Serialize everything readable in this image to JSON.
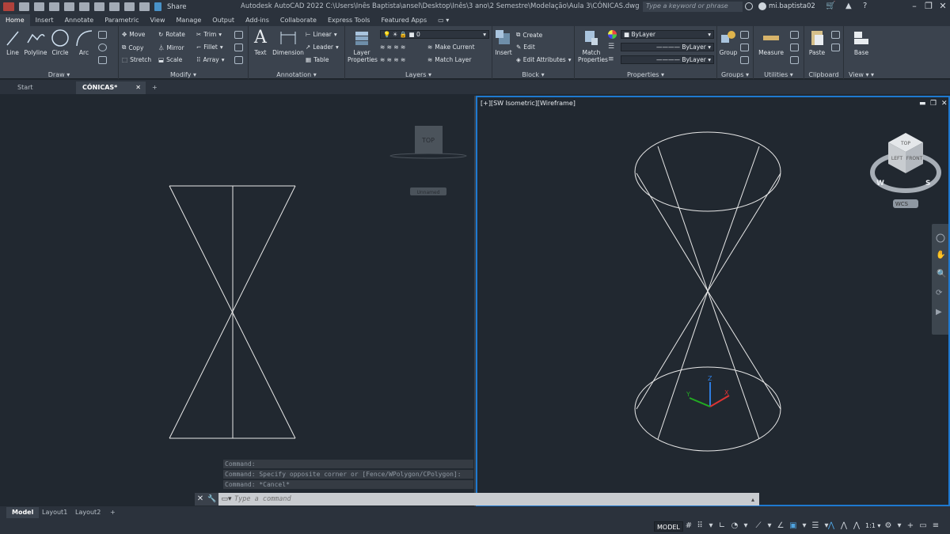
{
  "titlebar": {
    "app_title": "Autodesk AutoCAD 2022    C:\\Users\\Inês Baptista\\ansel\\Desktop\\Inês\\3 ano\\2 Semestre\\Modelação\\Aula 3\\CÓNICAS.dwg",
    "share_label": "Share",
    "search_placeholder": "Type a keyword or phrase",
    "username": "mi.baptista02"
  },
  "ribbon_tabs": [
    "Home",
    "Insert",
    "Annotate",
    "Parametric",
    "View",
    "Manage",
    "Output",
    "Add-ins",
    "Collaborate",
    "Express Tools",
    "Featured Apps"
  ],
  "ribbon": {
    "draw": {
      "title": "Draw",
      "line": "Line",
      "polyline": "Polyline",
      "circle": "Circle",
      "arc": "Arc"
    },
    "modify": {
      "title": "Modify",
      "move": "Move",
      "rotate": "Rotate",
      "trim": "Trim",
      "copy": "Copy",
      "mirror": "Mirror",
      "fillet": "Fillet",
      "stretch": "Stretch",
      "scale": "Scale",
      "array": "Array"
    },
    "annotation": {
      "title": "Annotation",
      "text": "Text",
      "dimension": "Dimension",
      "linear": "Linear",
      "leader": "Leader",
      "table": "Table"
    },
    "layers": {
      "title": "Layers",
      "layer_properties": "Layer Properties",
      "current_layer": "0",
      "make_current": "Make Current",
      "match_layer": "Match Layer"
    },
    "block": {
      "title": "Block",
      "insert": "Insert",
      "create": "Create",
      "edit": "Edit",
      "edit_attributes": "Edit Attributes"
    },
    "properties": {
      "title": "Properties",
      "match_properties": "Match Properties",
      "color": "ByLayer",
      "linetype": "ByLayer",
      "lineweight": "ByLayer"
    },
    "groups": {
      "title": "Groups",
      "group": "Group"
    },
    "utilities": {
      "title": "Utilities",
      "measure": "Measure"
    },
    "clipboard": {
      "title": "Clipboard",
      "paste": "Paste"
    },
    "view": {
      "title": "View",
      "base": "Base"
    }
  },
  "file_tabs": {
    "start": "Start",
    "active": "CÓNICAS*"
  },
  "viewport_left": {
    "viewcube_label": "TOP",
    "wcs_label": "Unnamed"
  },
  "viewport_right": {
    "label": "[+][SW Isometric][Wireframe]",
    "viewcube_top": "TOP",
    "viewcube_left": "LEFT",
    "viewcube_front": "FRONT",
    "compass_w": "W",
    "compass_s": "S",
    "wcs_label": "WCS"
  },
  "command_line": {
    "history": [
      "Command:",
      "Command: Specify opposite corner or [Fence/WPolygon/CPolygon]:",
      "Command: *Cancel*"
    ],
    "placeholder": "Type a command"
  },
  "layout_tabs": [
    "Model",
    "Layout1",
    "Layout2"
  ],
  "status": {
    "model": "MODEL",
    "scale": "1:1"
  }
}
